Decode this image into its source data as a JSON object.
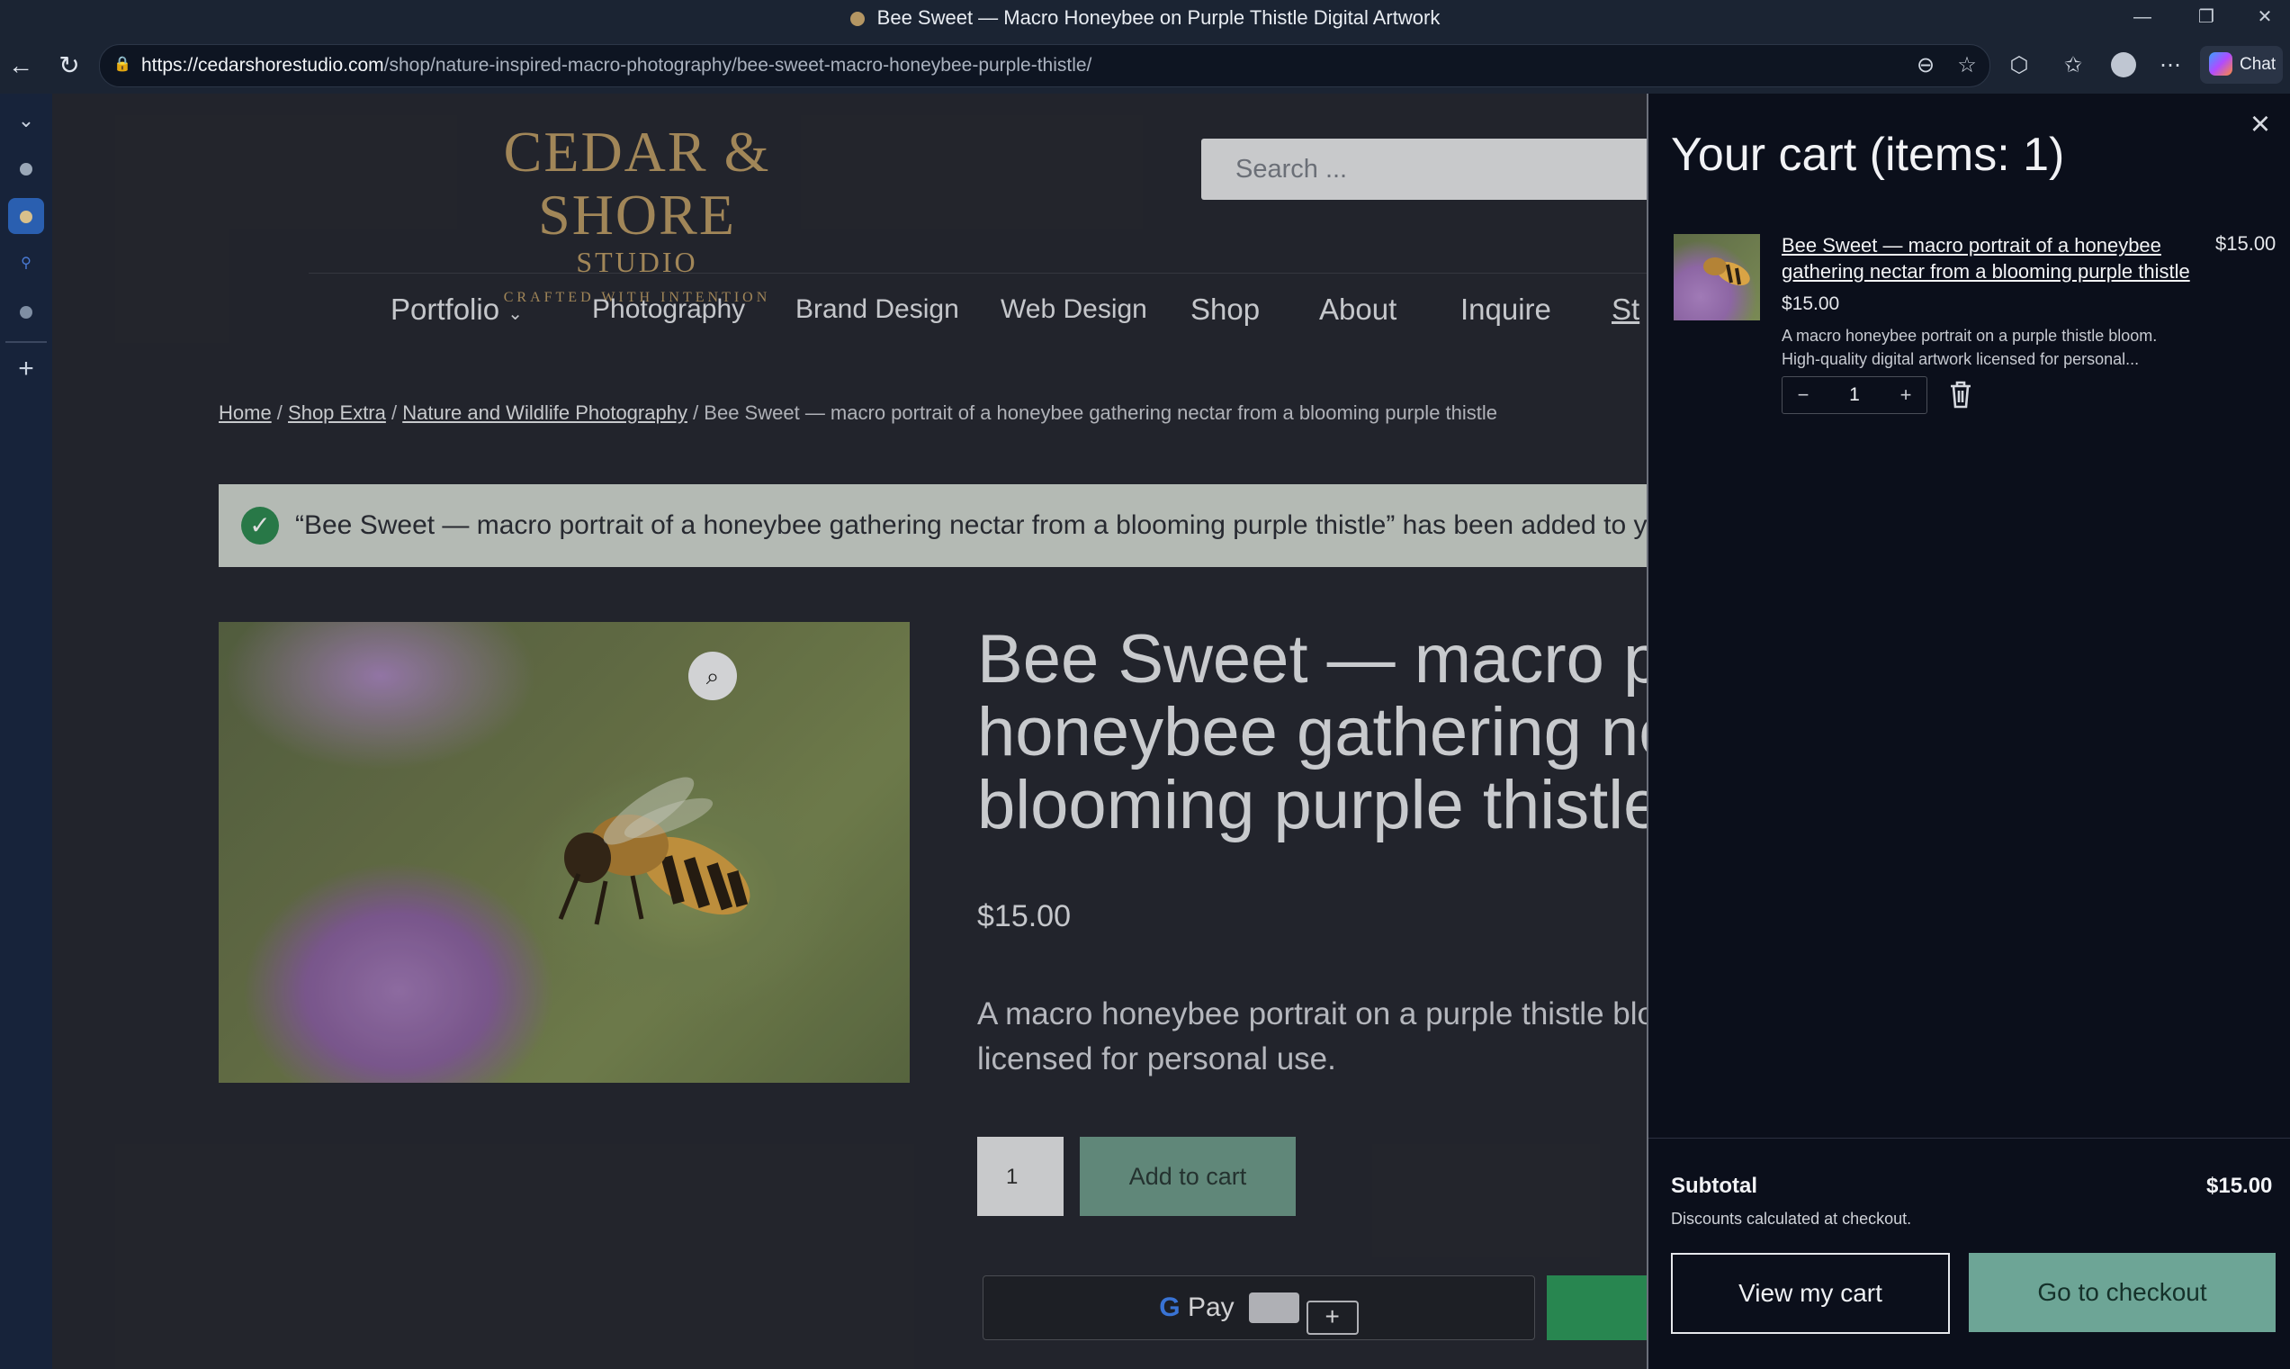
{
  "browser": {
    "title": "Bee Sweet — Macro Honeybee on Purple Thistle Digital Artwork",
    "url_domain": "https://cedarshorestudio.com",
    "url_path": "/shop/nature-inspired-macro-photography/bee-sweet-macro-honeybee-purple-thistle/",
    "chat_label": "Chat"
  },
  "site": {
    "logo": {
      "line1": "CEDAR & SHORE",
      "line2": "STUDIO",
      "tagline": "CRAFTED WITH INTENTION"
    },
    "search_placeholder": "Search ...",
    "nav": [
      "Portfolio",
      "Photography",
      "Brand Design",
      "Web Design",
      "Shop",
      "About",
      "Inquire",
      "St"
    ],
    "breadcrumb": {
      "home": "Home",
      "shop_extra": "Shop Extra",
      "category": "Nature and Wildlife Photography",
      "current": "/ Bee Sweet — macro portrait of a honeybee gathering nectar from a blooming purple thistle"
    },
    "notice": "“Bee Sweet — macro portrait of a honeybee gathering nectar from a blooming purple thistle” has been added to you",
    "product": {
      "title_lines": [
        "Bee Sweet — macro po",
        "honeybee gathering ne",
        "blooming purple thistle"
      ],
      "price": "$15.00",
      "desc_lines": [
        "A macro honeybee portrait on a purple thistle bloor",
        "licensed for personal use."
      ],
      "qty": "1",
      "add_to_cart": "Add to cart",
      "gpay_label": "Pay"
    }
  },
  "cart": {
    "heading": "Your cart (items: 1)",
    "item": {
      "name": "Bee Sweet — macro portrait of a honeybee gathering nectar from a blooming purple thistle",
      "price": "$15.00",
      "line_total": "$15.00",
      "description": "A macro honeybee portrait on a purple thistle bloom. High-quality digital artwork licensed for personal...",
      "quantity": "1"
    },
    "subtotal_label": "Subtotal",
    "subtotal_value": "$15.00",
    "discount_note": "Discounts calculated at checkout.",
    "view_cart": "View my cart",
    "checkout": "Go to checkout"
  }
}
